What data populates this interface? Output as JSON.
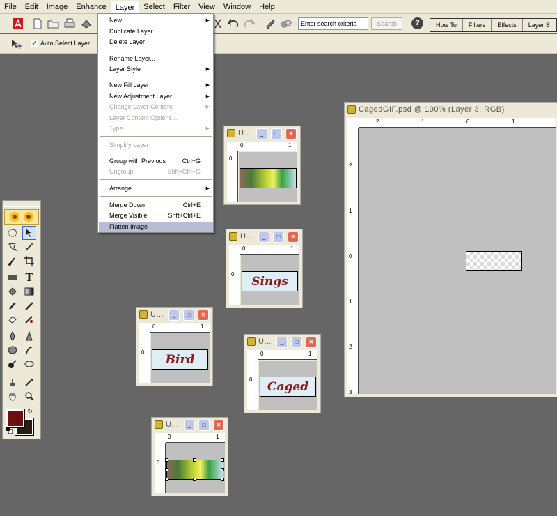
{
  "menubar": {
    "items": [
      "File",
      "Edit",
      "Image",
      "Enhance",
      "Layer",
      "Select",
      "Filter",
      "View",
      "Window",
      "Help"
    ],
    "active": "Layer"
  },
  "toolbar": {
    "search_placeholder": "Enter search criteria",
    "search_button": "Search",
    "help_icon": "?",
    "palette_tabs": [
      "How To",
      "Filters",
      "Effects",
      "Layer S"
    ]
  },
  "options_bar": {
    "auto_select_label": "Auto Select Layer",
    "auto_select_checked": true
  },
  "layer_menu": {
    "items": [
      {
        "label": "New",
        "submenu": true,
        "enabled": true
      },
      {
        "label": "Duplicate Layer...",
        "enabled": true
      },
      {
        "label": "Delete Layer",
        "enabled": true
      },
      {
        "label": "Rename Layer...",
        "enabled": true
      },
      {
        "label": "Layer Style",
        "submenu": true,
        "enabled": true
      },
      {
        "label": "New Fill Layer",
        "submenu": true,
        "enabled": true
      },
      {
        "label": "New Adjustment Layer",
        "submenu": true,
        "enabled": true
      },
      {
        "label": "Change Layer Content",
        "submenu": true,
        "enabled": false
      },
      {
        "label": "Layer Content Options...",
        "enabled": false
      },
      {
        "label": "Type",
        "submenu": true,
        "enabled": false
      },
      {
        "label": "Simplify Layer",
        "enabled": false
      },
      {
        "label": "Group with Previous",
        "shortcut": "Ctrl+G",
        "enabled": true
      },
      {
        "label": "Ungroup",
        "shortcut": "Shft+Ctrl+G",
        "enabled": false
      },
      {
        "label": "Arrange",
        "submenu": true,
        "enabled": true
      },
      {
        "label": "Merge Down",
        "shortcut": "Ctrl+E",
        "enabled": true
      },
      {
        "label": "Merge Visible",
        "shortcut": "Shft+Ctrl+E",
        "enabled": true
      },
      {
        "label": "Flatten Image",
        "enabled": true,
        "highlighted": true
      }
    ]
  },
  "colors": {
    "foreground": "#6d0f0f",
    "background": "#2a1d0b",
    "workspace": "#666666",
    "label_text": "#8a1a1a"
  },
  "documents": {
    "main": {
      "title": "CagedGIF.psd @ 100% (Layer 3, RGB)",
      "ruler_h": [
        "2",
        "1",
        "0",
        "1"
      ],
      "ruler_v": [
        "2",
        "1",
        "0",
        "1",
        "2",
        "3"
      ]
    },
    "win1": {
      "title": "U...",
      "ruler_h": [
        "0",
        "1"
      ],
      "ruler_v": [
        "0"
      ]
    },
    "win2": {
      "title": "U...",
      "ruler_h": [
        "0",
        "1"
      ],
      "ruler_v": [
        "0"
      ],
      "label": "Sings"
    },
    "win3": {
      "title": "U...",
      "ruler_h": [
        "0",
        "1"
      ],
      "ruler_v": [
        "0"
      ],
      "label": "Bird"
    },
    "win4": {
      "title": "U...",
      "ruler_h": [
        "0",
        "1"
      ],
      "ruler_v": [
        "0"
      ],
      "label": "Caged"
    },
    "win5": {
      "title": "U...",
      "ruler_h": [
        "0",
        "1"
      ],
      "ruler_v": [
        "0"
      ]
    }
  },
  "window_buttons": {
    "minimize": "_",
    "maximize": "□",
    "close": "✕"
  }
}
